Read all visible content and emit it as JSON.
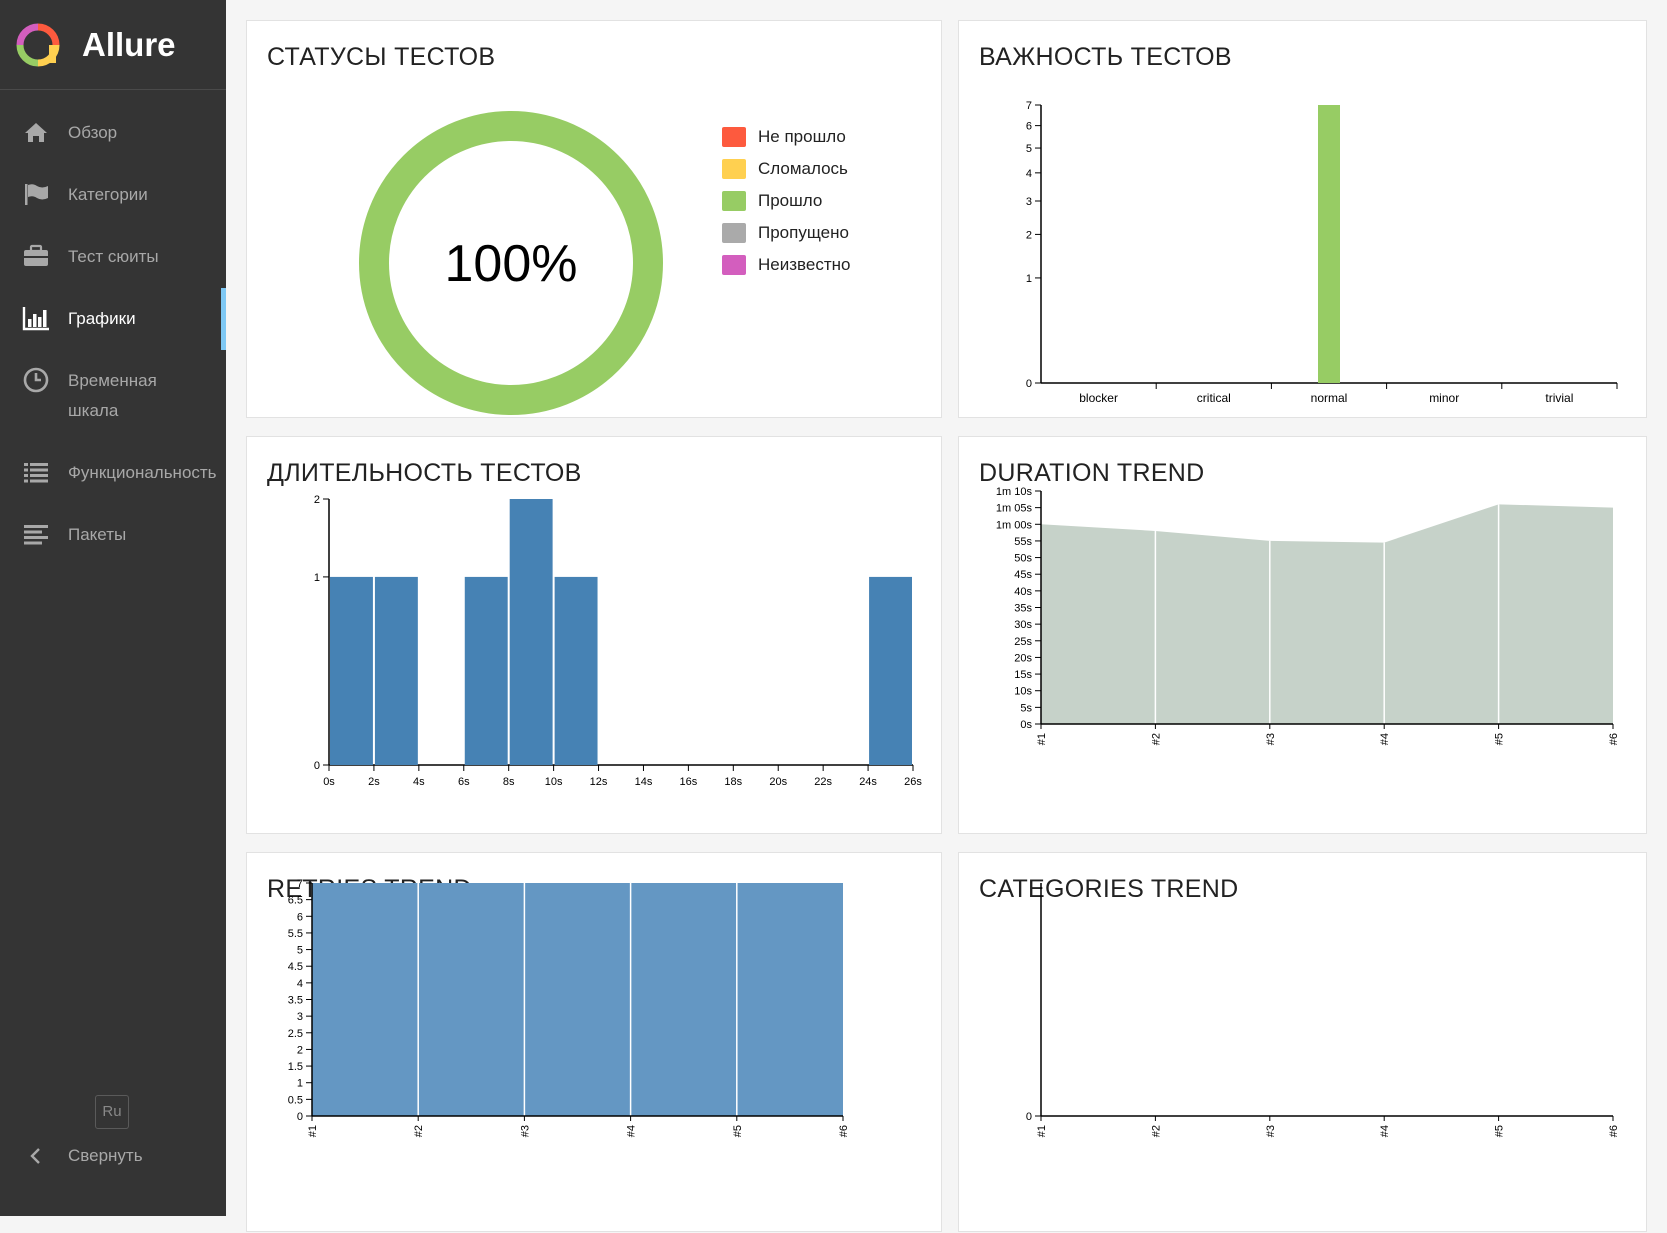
{
  "app": {
    "name": "Allure"
  },
  "sidebar": {
    "items": [
      {
        "label": "Обзор",
        "icon": "home-icon",
        "active": false
      },
      {
        "label": "Категории",
        "icon": "flag-icon",
        "active": false
      },
      {
        "label": "Тест сюиты",
        "icon": "briefcase-icon",
        "active": false
      },
      {
        "label": "Графики",
        "icon": "bar-chart-icon",
        "active": true
      },
      {
        "label": "Временная шкала",
        "icon": "clock-icon",
        "active": false
      },
      {
        "label": "Функциональность",
        "icon": "list-icon",
        "active": false
      },
      {
        "label": "Пакеты",
        "icon": "packages-icon",
        "active": false
      }
    ],
    "language": "Ru",
    "collapse_label": "Свернуть"
  },
  "panels": {
    "statuses": {
      "title": "СТАТУСЫ ТЕСТОВ"
    },
    "severity": {
      "title": "ВАЖНОСТЬ ТЕСТОВ"
    },
    "duration": {
      "title": "ДЛИТЕЛЬНОСТЬ ТЕСТОВ"
    },
    "duration_trend": {
      "title": "DURATION TREND"
    },
    "retries_trend": {
      "title": "RETRIES TREND"
    },
    "categories_trend": {
      "title": "CATEGORIES TREND"
    }
  },
  "chart_data": [
    {
      "id": "statuses",
      "type": "pie",
      "center_label": "100%",
      "legend": [
        {
          "label": "Не прошло",
          "color": "#fd5a3e"
        },
        {
          "label": "Сломалось",
          "color": "#ffd050"
        },
        {
          "label": "Прошло",
          "color": "#97cc64"
        },
        {
          "label": "Пропущено",
          "color": "#aaaaaa"
        },
        {
          "label": "Неизвестно",
          "color": "#d35ebe"
        }
      ],
      "values": [
        0,
        0,
        7,
        0,
        0
      ]
    },
    {
      "id": "severity",
      "type": "bar",
      "categories": [
        "blocker",
        "critical",
        "normal",
        "minor",
        "trivial"
      ],
      "values": [
        0,
        0,
        7,
        0,
        0
      ],
      "y_ticks": [
        "0",
        "1",
        "2",
        "3",
        "4",
        "5",
        "6",
        "7"
      ],
      "ylim": [
        0,
        7
      ],
      "scale": "sqrt",
      "color": "#97cc64"
    },
    {
      "id": "duration",
      "type": "bar",
      "x_ticks": [
        "0s",
        "2s",
        "4s",
        "6s",
        "8s",
        "10s",
        "12s",
        "14s",
        "16s",
        "18s",
        "20s",
        "22s",
        "24s",
        "26s"
      ],
      "bins": [
        {
          "from": 0,
          "to": 2,
          "count": 1
        },
        {
          "from": 2,
          "to": 4,
          "count": 1
        },
        {
          "from": 6,
          "to": 8,
          "count": 1
        },
        {
          "from": 8,
          "to": 10,
          "count": 2
        },
        {
          "from": 10,
          "to": 12,
          "count": 1
        },
        {
          "from": 24,
          "to": 26,
          "count": 1
        }
      ],
      "y_ticks": [
        "0",
        "1",
        "2"
      ],
      "ylim": [
        0,
        2
      ],
      "xlim": [
        0,
        26
      ],
      "scale": "sqrt",
      "color": "#4682b4"
    },
    {
      "id": "duration_trend",
      "type": "area",
      "x": [
        "#1",
        "#2",
        "#3",
        "#4",
        "#5",
        "#6"
      ],
      "values_s": [
        60,
        58,
        55,
        54.5,
        66,
        65
      ],
      "y_ticks": [
        "0s",
        "5s",
        "10s",
        "15s",
        "20s",
        "25s",
        "30s",
        "35s",
        "40s",
        "45s",
        "50s",
        "55s",
        "1m 00s",
        "1m 05s",
        "1m 10s"
      ],
      "ylim": [
        0,
        70
      ],
      "color": "#c6d2c9"
    },
    {
      "id": "retries_trend",
      "type": "area",
      "x": [
        "#1",
        "#2",
        "#3",
        "#4",
        "#5",
        "#6"
      ],
      "values": [
        7,
        7,
        7,
        7,
        7,
        7
      ],
      "y_ticks": [
        "0",
        "0.5",
        "1",
        "1.5",
        "2",
        "2.5",
        "3",
        "3.5",
        "4",
        "4.5",
        "5",
        "5.5",
        "6",
        "6.5",
        "7"
      ],
      "ylim": [
        0,
        7
      ],
      "color": "#6497c3"
    },
    {
      "id": "categories_trend",
      "type": "area",
      "x": [
        "#1",
        "#2",
        "#3",
        "#4",
        "#5",
        "#6"
      ],
      "values": [
        0,
        0,
        0,
        0,
        0,
        0
      ],
      "y_ticks": [
        "0"
      ],
      "ylim": [
        0,
        1
      ]
    }
  ]
}
